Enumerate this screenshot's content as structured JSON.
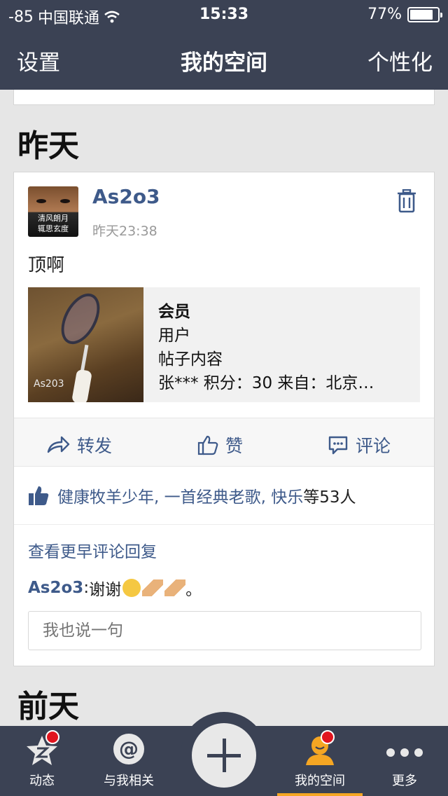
{
  "status_bar": {
    "signal": "-85",
    "carrier": "中国联通",
    "time": "15:33",
    "battery": "77%"
  },
  "nav": {
    "left": "设置",
    "title": "我的空间",
    "right": "个性化"
  },
  "sections": [
    {
      "title": "昨天"
    },
    {
      "title": "前天"
    }
  ],
  "post": {
    "avatar_text_1": "清风朗月",
    "avatar_text_2": "辄思玄度",
    "username": "As2o3",
    "time": "昨天23:38",
    "text": "顶啊",
    "share": {
      "thumb_watermark": "As203",
      "line1": "会员",
      "line2": "用户",
      "line3": "帖子内容",
      "line4": " 张*** 积分：30 来自：北京…"
    },
    "actions": {
      "forward": "转发",
      "like": "赞",
      "comment": "评论"
    },
    "likes": {
      "names": "健康牧羊少年, 一首经典老歌, 快乐",
      "suffix": "等53人"
    },
    "more_comments": "查看更早评论回复",
    "comment": {
      "user": "As2o3",
      "sep": ": ",
      "text": "谢谢",
      "end": "。"
    },
    "reply_placeholder": "我也说一句"
  },
  "tabs": [
    {
      "label": "动态"
    },
    {
      "label": "与我相关"
    },
    {
      "label": "我的空间"
    },
    {
      "label": "更多"
    }
  ],
  "colors": {
    "bar": "#3b4254",
    "link": "#3e5a8a",
    "badge": "#e0141e",
    "active": "#f5a623"
  }
}
